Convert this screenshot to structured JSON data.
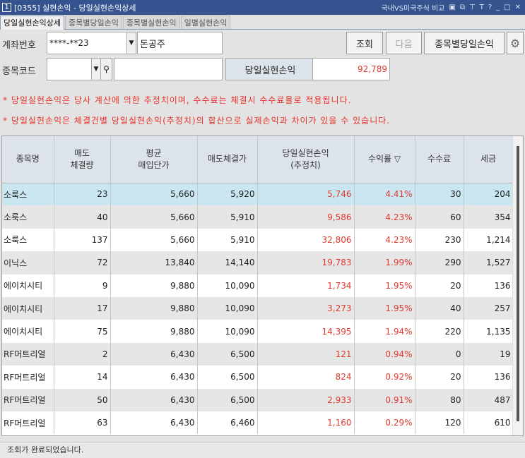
{
  "window": {
    "number": "1",
    "title": "[0355]  실현손익 - 당일실현손익상세",
    "compare_link": "국내VS미국주식 비교",
    "icons": [
      "window-restore-icon",
      "copy-icon",
      "pin-icon",
      "font-icon",
      "help-icon",
      "minimize-icon",
      "maximize-icon",
      "close-icon"
    ]
  },
  "tabs": [
    "당일실현손익상세",
    "종목별당일손익",
    "종목별실현손익",
    "일별실현손익"
  ],
  "form": {
    "account_label": "계좌번호",
    "account_value": "****-**23",
    "account_name": "돈공주",
    "stock_label": "종목코드",
    "stock_code": "",
    "stock_name": "",
    "summary_label": "당일실현손익",
    "summary_value": "92,789"
  },
  "buttons": {
    "query": "조회",
    "next": "다음",
    "by_stock": "종목별당일손익"
  },
  "notes": [
    "* 당일실현손익은 당사 계산에 의한 추정치이며, 수수료는 체결시 수수료율로 적용됩니다.",
    "* 당일실현손익은 체결건별 당일실현손익(추정치)의 합산으로 실제손익과 차이가 있을 수 있습니다."
  ],
  "table": {
    "headers": [
      [
        "종목명"
      ],
      [
        "매도",
        "체결량"
      ],
      [
        "평균",
        "매입단가"
      ],
      [
        "매도체결가"
      ],
      [
        "당일실현손익",
        "(추정치)"
      ],
      [
        "수익률 ▽"
      ],
      [
        "수수료"
      ],
      [
        "세금"
      ]
    ],
    "rows": [
      [
        "소룩스",
        "23",
        "5,660",
        "5,920",
        "5,746",
        "4.41%",
        "30",
        "204"
      ],
      [
        "소룩스",
        "40",
        "5,660",
        "5,910",
        "9,586",
        "4.23%",
        "60",
        "354"
      ],
      [
        "소룩스",
        "137",
        "5,660",
        "5,910",
        "32,806",
        "4.23%",
        "230",
        "1,214"
      ],
      [
        "이닉스",
        "72",
        "13,840",
        "14,140",
        "19,783",
        "1.99%",
        "290",
        "1,527"
      ],
      [
        "에이치시티",
        "9",
        "9,880",
        "10,090",
        "1,734",
        "1.95%",
        "20",
        "136"
      ],
      [
        "에이치시티",
        "17",
        "9,880",
        "10,090",
        "3,273",
        "1.95%",
        "40",
        "257"
      ],
      [
        "에이치시티",
        "75",
        "9,880",
        "10,090",
        "14,395",
        "1.94%",
        "220",
        "1,135"
      ],
      [
        "RF머트리얼",
        "2",
        "6,430",
        "6,500",
        "121",
        "0.94%",
        "0",
        "19"
      ],
      [
        "RF머트리얼",
        "14",
        "6,430",
        "6,500",
        "824",
        "0.92%",
        "20",
        "136"
      ],
      [
        "RF머트리얼",
        "50",
        "6,430",
        "6,500",
        "2,933",
        "0.91%",
        "80",
        "487"
      ],
      [
        "RF머트리얼",
        "63",
        "6,430",
        "6,460",
        "1,160",
        "0.29%",
        "120",
        "610"
      ]
    ]
  },
  "status": "조회가 완료되었습니다."
}
